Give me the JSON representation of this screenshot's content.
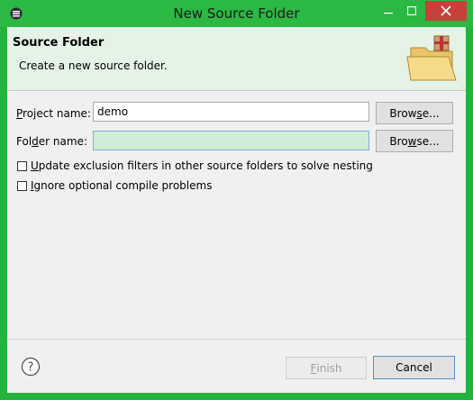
{
  "window": {
    "title": "New Source Folder"
  },
  "banner": {
    "title": "Source Folder",
    "description": "Create a new source folder.",
    "icon": "folder-with-package-icon"
  },
  "form": {
    "project_label": {
      "prefix": "",
      "mnemonic": "P",
      "rest": "roject name:"
    },
    "project_value": "demo",
    "project_browse": {
      "prefix": "Brow",
      "mnemonic": "s",
      "rest": "e..."
    },
    "folder_label": {
      "prefix": "Fol",
      "mnemonic": "d",
      "rest": "er name:"
    },
    "folder_value": "",
    "folder_browse": {
      "prefix": "Bro",
      "mnemonic": "w",
      "rest": "se..."
    },
    "update_exclusion": {
      "prefix": "",
      "mnemonic": "U",
      "rest": "pdate exclusion filters in other source folders to solve nesting",
      "checked": false
    },
    "ignore_optional": {
      "prefix": "",
      "mnemonic": "I",
      "rest": "gnore optional compile problems",
      "checked": false
    }
  },
  "footer": {
    "finish": {
      "prefix": "",
      "mnemonic": "F",
      "rest": "inish",
      "enabled": false
    },
    "cancel_label": "Cancel",
    "help_icon": "help-icon"
  },
  "colors": {
    "title_bar": "#2bb843",
    "banner_bg": "#e4f3e6",
    "close_button": "#c7413a"
  }
}
